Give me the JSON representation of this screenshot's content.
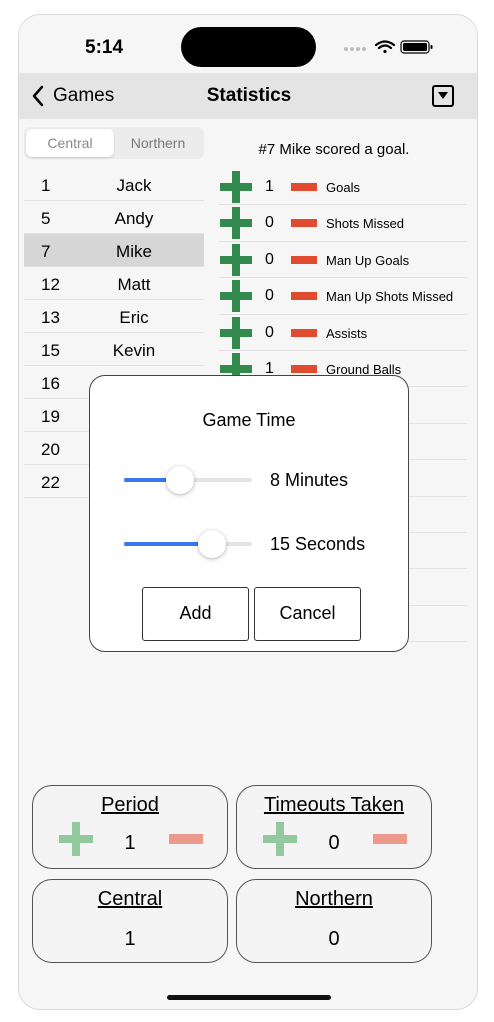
{
  "status_bar": {
    "time": "5:14"
  },
  "nav": {
    "back_label": "Games",
    "title": "Statistics",
    "menu_icon": "dropdown-box-icon"
  },
  "segments": {
    "items": [
      "Central",
      "Northern"
    ],
    "selected": "Central"
  },
  "roster": [
    {
      "number": "1",
      "name": "Jack"
    },
    {
      "number": "5",
      "name": "Andy"
    },
    {
      "number": "7",
      "name": "Mike"
    },
    {
      "number": "12",
      "name": "Matt"
    },
    {
      "number": "13",
      "name": "Eric"
    },
    {
      "number": "15",
      "name": "Kevin"
    },
    {
      "number": "16",
      "name": ""
    },
    {
      "number": "19",
      "name": ""
    },
    {
      "number": "20",
      "name": ""
    },
    {
      "number": "22",
      "name": ""
    }
  ],
  "selected_player": "Mike",
  "last_action": "#7 Mike scored a goal.",
  "stats": [
    {
      "value": "1",
      "label": "Goals"
    },
    {
      "value": "0",
      "label": "Shots Missed"
    },
    {
      "value": "0",
      "label": "Man Up Goals"
    },
    {
      "value": "0",
      "label": "Man Up Shots Missed"
    },
    {
      "value": "0",
      "label": "Assists"
    },
    {
      "value": "1",
      "label": "Ground Balls"
    }
  ],
  "modal": {
    "title": "Game Time",
    "minutes_label": "8 Minutes",
    "seconds_label": "15 Seconds",
    "minutes_fraction": 0.44,
    "seconds_fraction": 0.69,
    "add_label": "Add",
    "cancel_label": "Cancel"
  },
  "cards": {
    "period": {
      "title": "Period",
      "value": "1"
    },
    "timeouts": {
      "title": "Timeouts Taken",
      "value": "0"
    },
    "central": {
      "title": "Central",
      "value": "1"
    },
    "northern": {
      "title": "Northern",
      "value": "0"
    }
  },
  "colors": {
    "plus_green": "#338a4e",
    "minus_red": "#e04a2f",
    "slider_blue": "#3478f6",
    "card_plus_green": "#94c9a0",
    "card_minus_red": "#ec9a8c"
  }
}
